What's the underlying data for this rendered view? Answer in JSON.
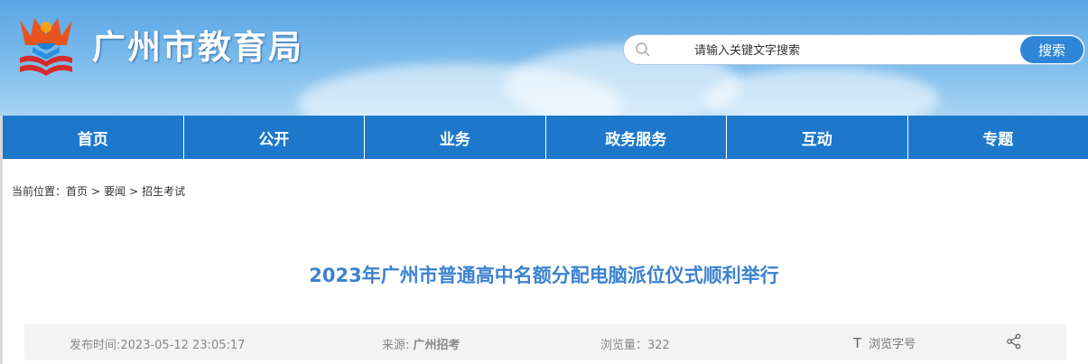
{
  "header": {
    "site_title": "广州市教育局",
    "search": {
      "placeholder": "请输入关键文字搜索",
      "button_label": "搜索"
    }
  },
  "nav": {
    "items": [
      {
        "label": "首页"
      },
      {
        "label": "公开"
      },
      {
        "label": "业务"
      },
      {
        "label": "政务服务"
      },
      {
        "label": "互动"
      },
      {
        "label": "专题"
      }
    ]
  },
  "breadcrumb": {
    "prefix": "当前位置：",
    "items": [
      "首页",
      "要闻",
      "招生考试"
    ],
    "separator": ">"
  },
  "article": {
    "title": "2023年广州市普通高中名额分配电脑派位仪式顺利举行",
    "meta": {
      "publish_time": "发布时间:2023-05-12 23:05:17",
      "source_label": "来源: ",
      "source_value": "广州招考",
      "views": "浏览量：322",
      "font_size_label": "浏览字号"
    }
  },
  "colors": {
    "nav_bg": "#1d78cc",
    "title": "#3c82cf",
    "search_button": "#2f86d8"
  }
}
